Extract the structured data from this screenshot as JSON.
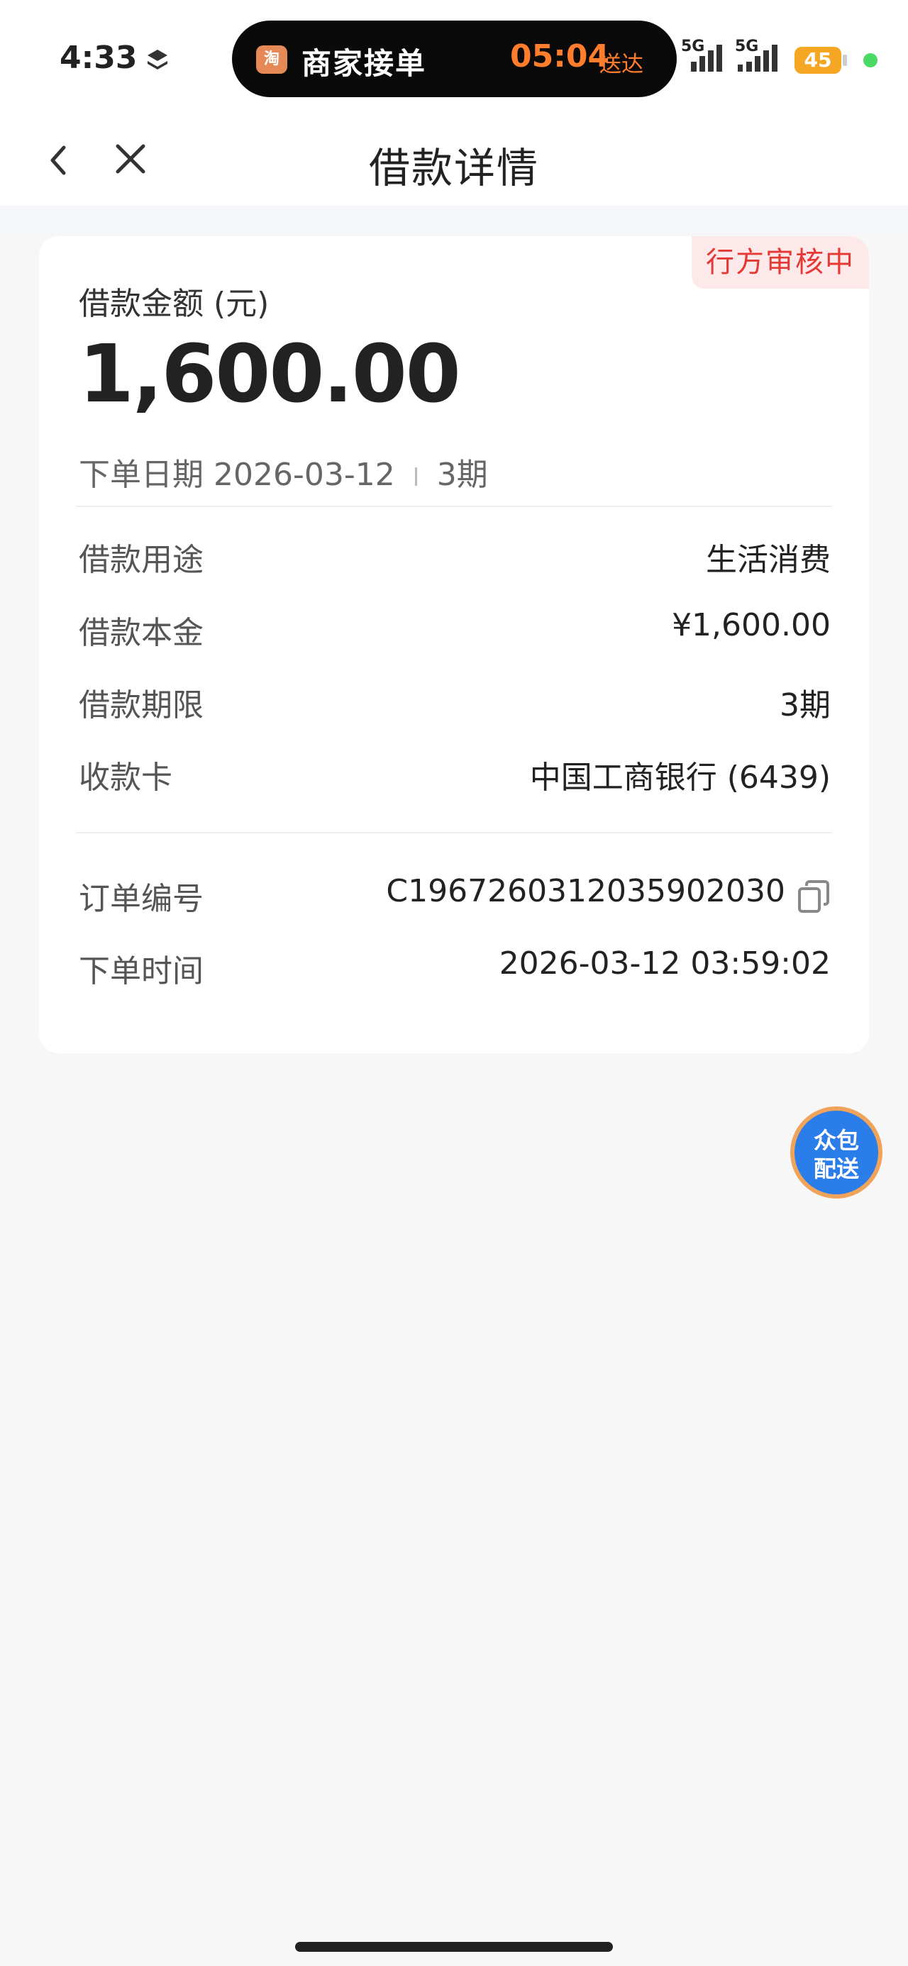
{
  "status_bar": {
    "time": "4:33",
    "island_app_icon_text": "淘",
    "island_title": "商家接单",
    "island_time": "05:04",
    "island_suffix": "送达",
    "network1": "5G",
    "network2": "5G",
    "battery": "45"
  },
  "nav": {
    "title": "借款详情"
  },
  "card": {
    "status_badge": "行方审核中",
    "amount_label": "借款金额 (元)",
    "amount_value": "1,600.00",
    "order_date_label": "下单日期",
    "order_date": "2026-03-12",
    "periods": "3期",
    "details": [
      {
        "label": "借款用途",
        "value": "生活消费"
      },
      {
        "label": "借款本金",
        "value": "¥1,600.00"
      },
      {
        "label": "借款期限",
        "value": "3期"
      },
      {
        "label": "收款卡",
        "value": "中国工商银行 (6439)"
      }
    ],
    "order_no_label": "订单编号",
    "order_no": "C1967260312035902030",
    "order_time_label": "下单时间",
    "order_time": "2026-03-12 03:59:02"
  },
  "fab": {
    "line1": "众包",
    "line2": "配送"
  },
  "colors": {
    "accent_orange": "#ff7d2d",
    "badge_red": "#e53935",
    "badge_bg": "#fde9e9",
    "fab_blue": "#2b7de9"
  }
}
